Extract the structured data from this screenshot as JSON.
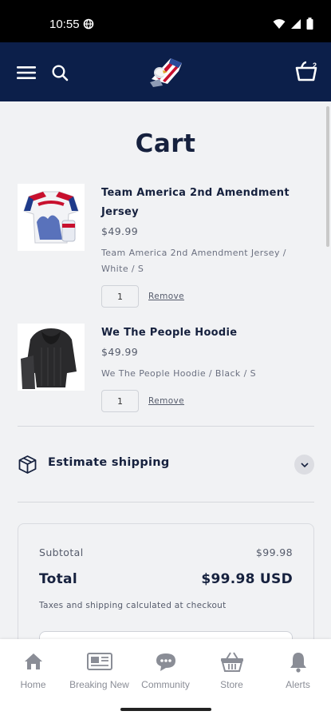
{
  "status_bar": {
    "time": "10:55"
  },
  "header": {
    "cart_count": "2"
  },
  "page": {
    "title": "Cart"
  },
  "cart_items": [
    {
      "name": "Team America 2nd Amendment Jersey",
      "price": "$49.99",
      "variant": "Team America 2nd Amendment Jersey / White / S",
      "quantity": "1",
      "remove_label": "Remove"
    },
    {
      "name": "We The People Hoodie",
      "price": "$49.99",
      "variant": "We The People Hoodie / Black / S",
      "quantity": "1",
      "remove_label": "Remove"
    }
  ],
  "shipping": {
    "label": "Estimate shipping"
  },
  "summary": {
    "subtotal_label": "Subtotal",
    "subtotal_value": "$99.98",
    "total_label": "Total",
    "total_value": "$99.98 USD",
    "tax_note": "Taxes and shipping calculated at checkout"
  },
  "bottom_nav": [
    {
      "label": "Home",
      "icon": "home-icon"
    },
    {
      "label": "Breaking New",
      "icon": "newspaper-icon"
    },
    {
      "label": "Community",
      "icon": "chat-bubble-icon"
    },
    {
      "label": "Store",
      "icon": "basket-icon"
    },
    {
      "label": "Alerts",
      "icon": "bell-icon"
    }
  ],
  "colors": {
    "header_bg": "#0c1f4a",
    "page_bg": "#f1f2f4",
    "text_primary": "#16213e"
  }
}
